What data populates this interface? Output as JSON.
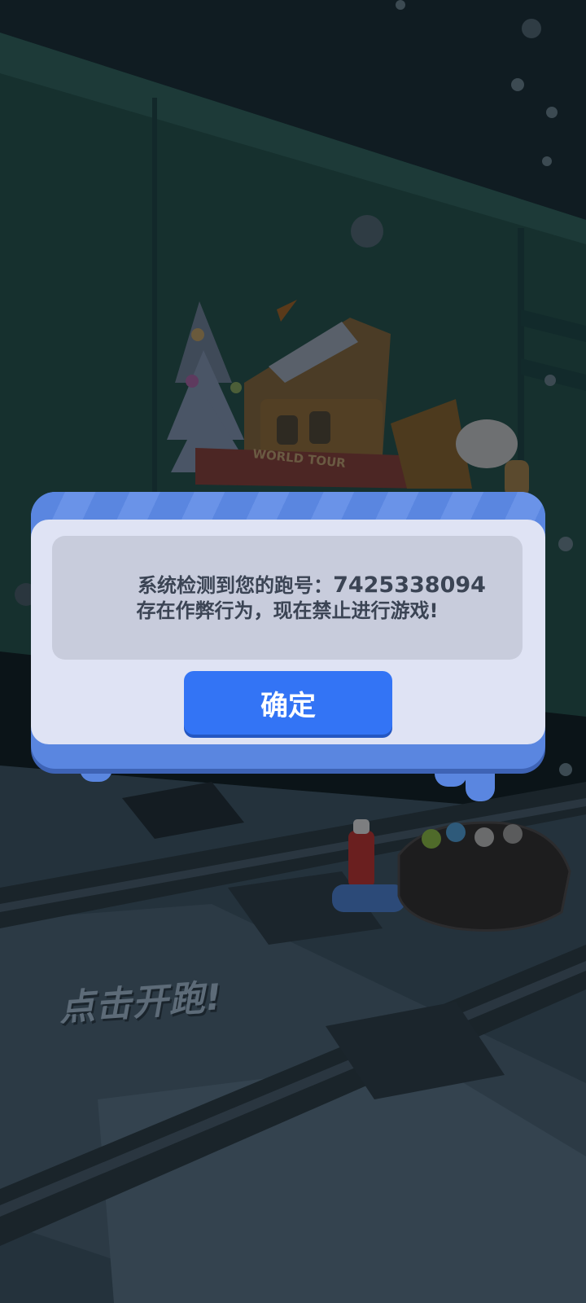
{
  "game": {
    "tap_hint": "点击开跑!",
    "world_tour_label": "WORLD TOUR"
  },
  "dialog": {
    "message_prefix": "系统检测到您的跑号：",
    "runner_id": "7425338094",
    "message_line2": "存在作弊行为，现在禁止进行游戏!",
    "confirm_label": "确定"
  },
  "colors": {
    "dialog_frame": "#5a86e0",
    "dialog_inner": "#dfe3f4",
    "message_box": "#c8ccdc",
    "confirm_button": "#3374f5",
    "background": "#0f1a20"
  },
  "icons": [
    "snow-tree-icon",
    "castle-logo-icon",
    "spray-can-icon",
    "duffel-bag-icon"
  ]
}
